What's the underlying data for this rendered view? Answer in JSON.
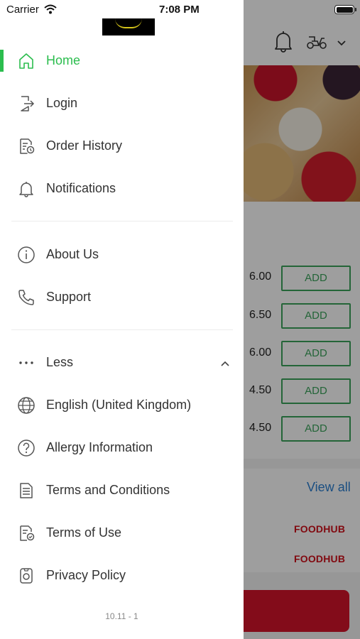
{
  "status_bar": {
    "carrier": "Carrier",
    "time": "7:08 PM"
  },
  "drawer": {
    "menu": [
      {
        "label": "Home",
        "icon": "home-icon",
        "active": true
      },
      {
        "label": "Login",
        "icon": "login-icon"
      },
      {
        "label": "Order History",
        "icon": "order-history-icon"
      },
      {
        "label": "Notifications",
        "icon": "bell-icon"
      },
      {
        "label": "About Us",
        "icon": "info-icon"
      },
      {
        "label": "Support",
        "icon": "phone-icon"
      },
      {
        "label": "Less",
        "icon": "more-dots-icon"
      },
      {
        "label": "English (United Kingdom)",
        "icon": "globe-icon"
      },
      {
        "label": "Allergy Information",
        "icon": "help-circle-icon"
      },
      {
        "label": "Terms and Conditions",
        "icon": "document-icon"
      },
      {
        "label": "Terms of Use",
        "icon": "document-check-icon"
      },
      {
        "label": "Privacy Policy",
        "icon": "privacy-icon"
      }
    ],
    "version": "10.11 - 1",
    "accent_color": "#2bbd4e"
  },
  "background": {
    "prices": [
      "6.00",
      "6.50",
      "6.00",
      "4.50",
      "4.50"
    ],
    "add_label": "ADD",
    "view_all": "View all",
    "brand": "FOODHUB",
    "add_color": "#3aa35b",
    "cta_color": "#d4142a"
  }
}
